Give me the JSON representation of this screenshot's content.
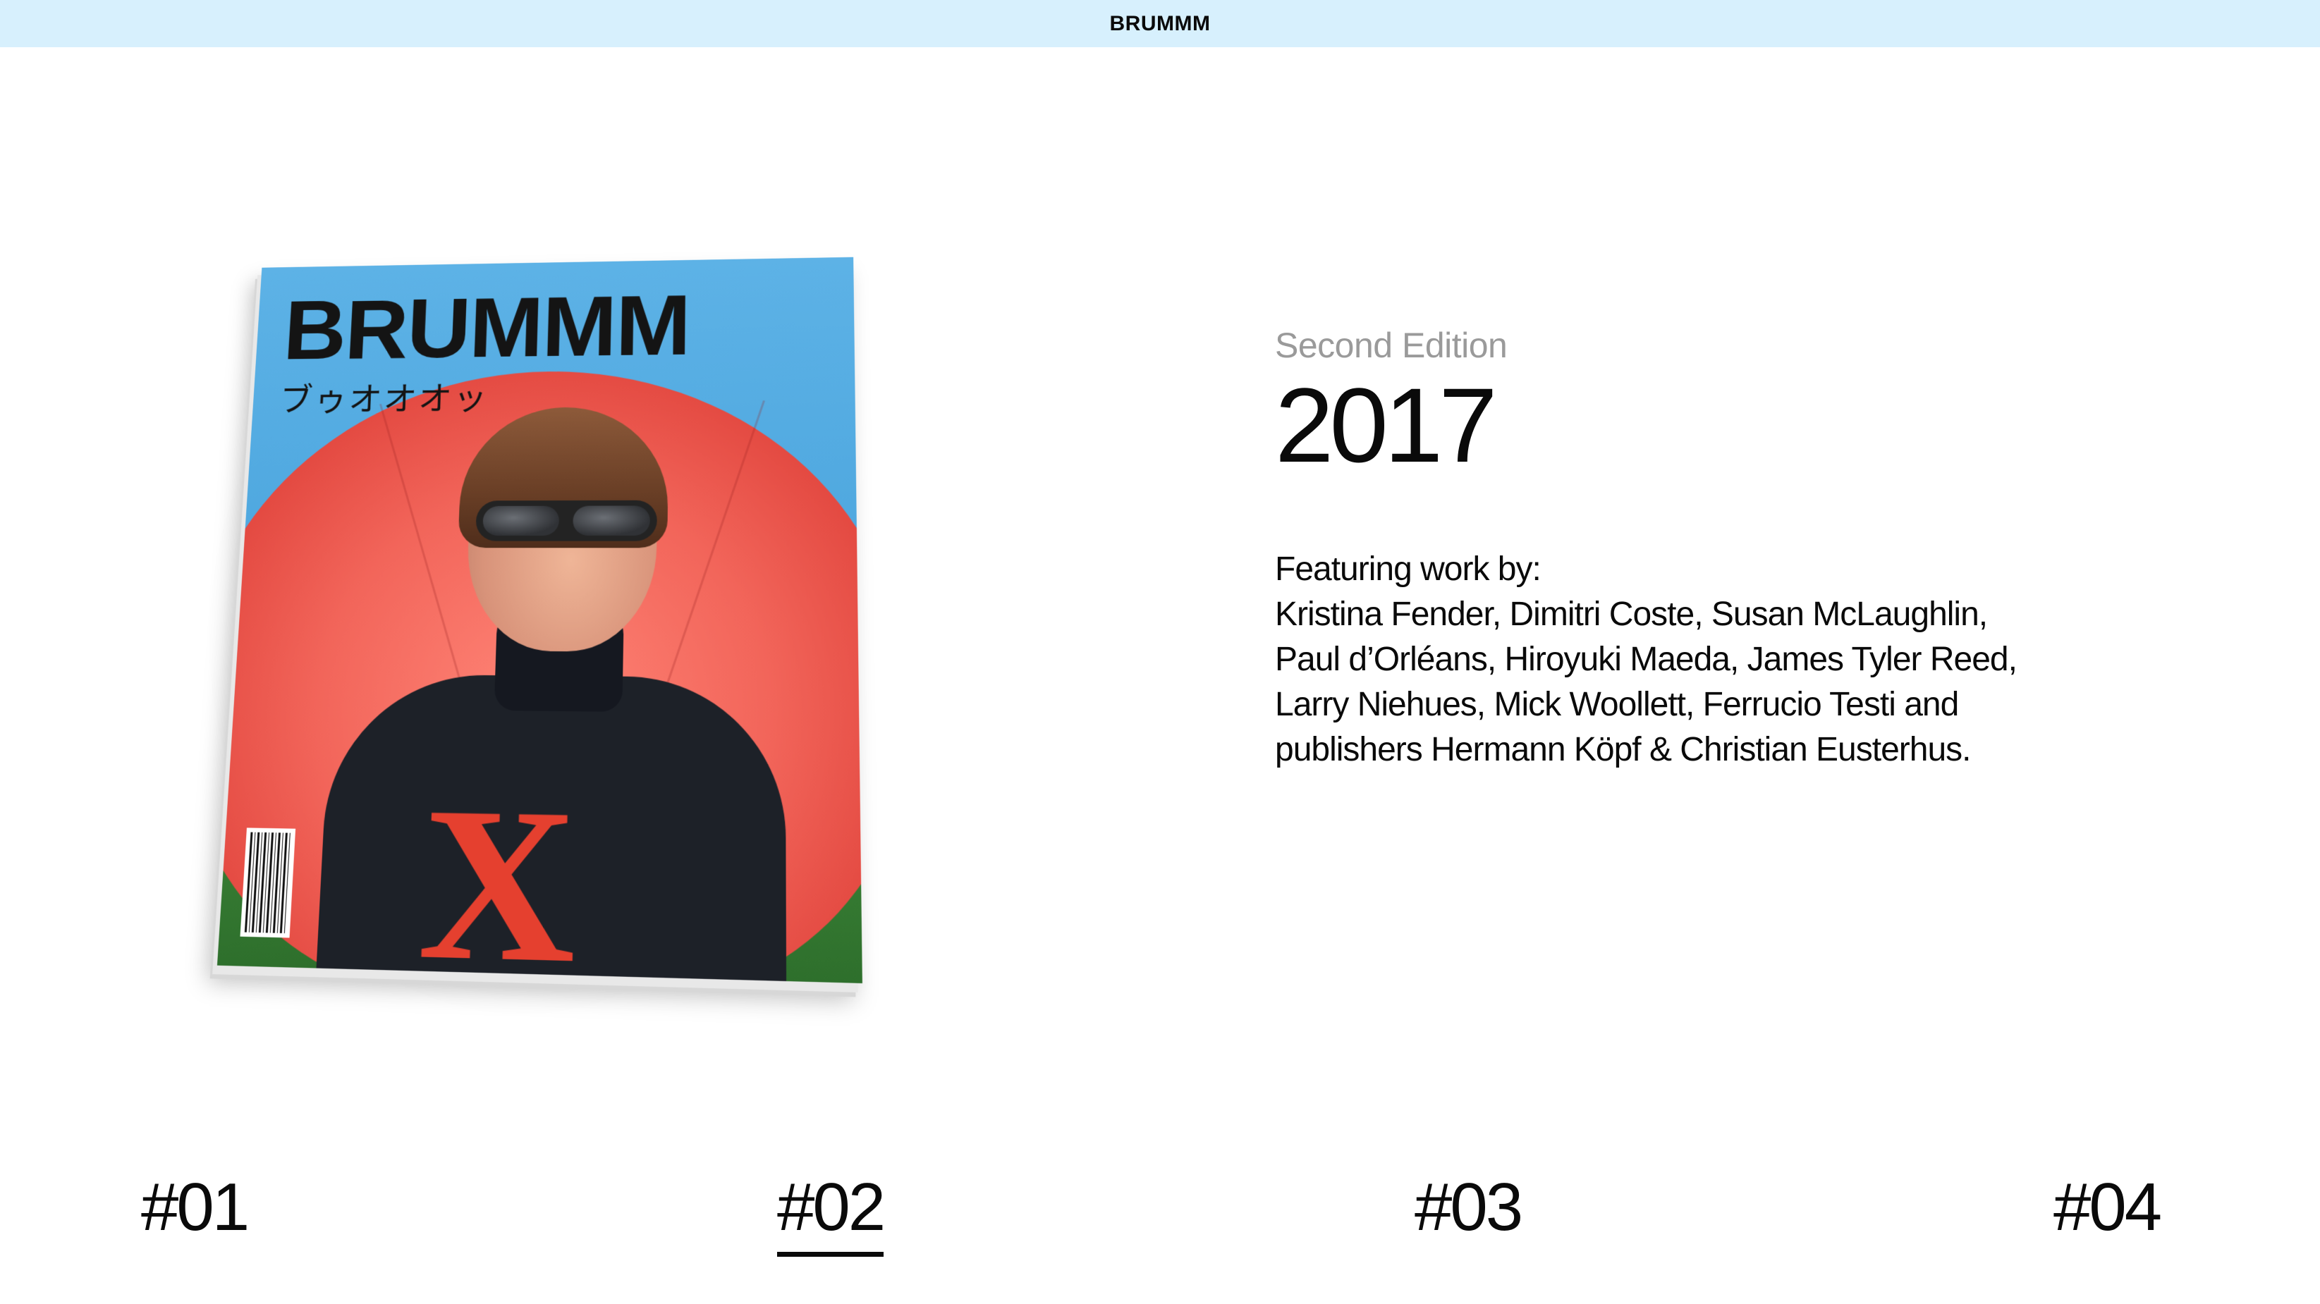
{
  "header": {
    "brand": "BRUMMM"
  },
  "cover": {
    "title": "BRUMMM",
    "subtitle_kana": "ブゥオオオッ",
    "emblem": "X",
    "colors": {
      "sky": "#5db2e6",
      "umbrella": "#f2655a",
      "shirt": "#1d2128",
      "emblem": "#e5402f"
    }
  },
  "edition": {
    "label": "Second Edition",
    "year": "2017",
    "featuring_lines": [
      "Featuring work by:",
      "Kristina Fender, Dimitri Coste, Susan McLaughlin,",
      "Paul d’Orléans, Hiroyuki Maeda, James Tyler Reed,",
      "Larry Niehues, Mick Woollett, Ferrucio Testi and",
      "publishers Hermann Köpf & Christian Eusterhus."
    ]
  },
  "edition_nav": {
    "items": [
      {
        "label": "#01",
        "active": false
      },
      {
        "label": "#02",
        "active": true
      },
      {
        "label": "#03",
        "active": false
      },
      {
        "label": "#04",
        "active": false
      }
    ]
  }
}
